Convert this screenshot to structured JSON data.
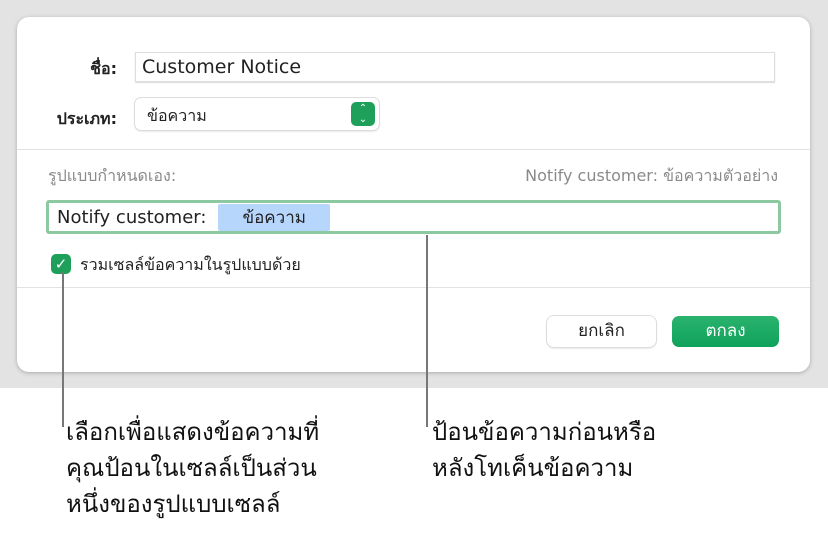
{
  "dialog": {
    "name_label": "ชื่อ:",
    "name_value": "Customer Notice",
    "type_label": "ประเภท:",
    "type_value": "ข้อความ",
    "custom_format_label": "รูปแบบกำหนดเอง:",
    "preview": "Notify customer: ข้อความตัวอย่าง",
    "format_text": "Notify customer:",
    "format_token": "ข้อความ",
    "include_checkbox_label": "รวมเซลล์ข้อความในรูปแบบด้วย",
    "include_checked": true,
    "cancel_label": "ยกเลิก",
    "ok_label": "ตกลง"
  },
  "callouts": {
    "left": [
      "เลือกเพื่อแสดงข้อความที่",
      "คุณป้อนในเซลล์เป็นส่วน",
      "หนึ่งของรูปแบบเซลล์"
    ],
    "right": [
      "ป้อนข้อความก่อนหรือ",
      "หลังโทเค็นข้อความ"
    ]
  }
}
